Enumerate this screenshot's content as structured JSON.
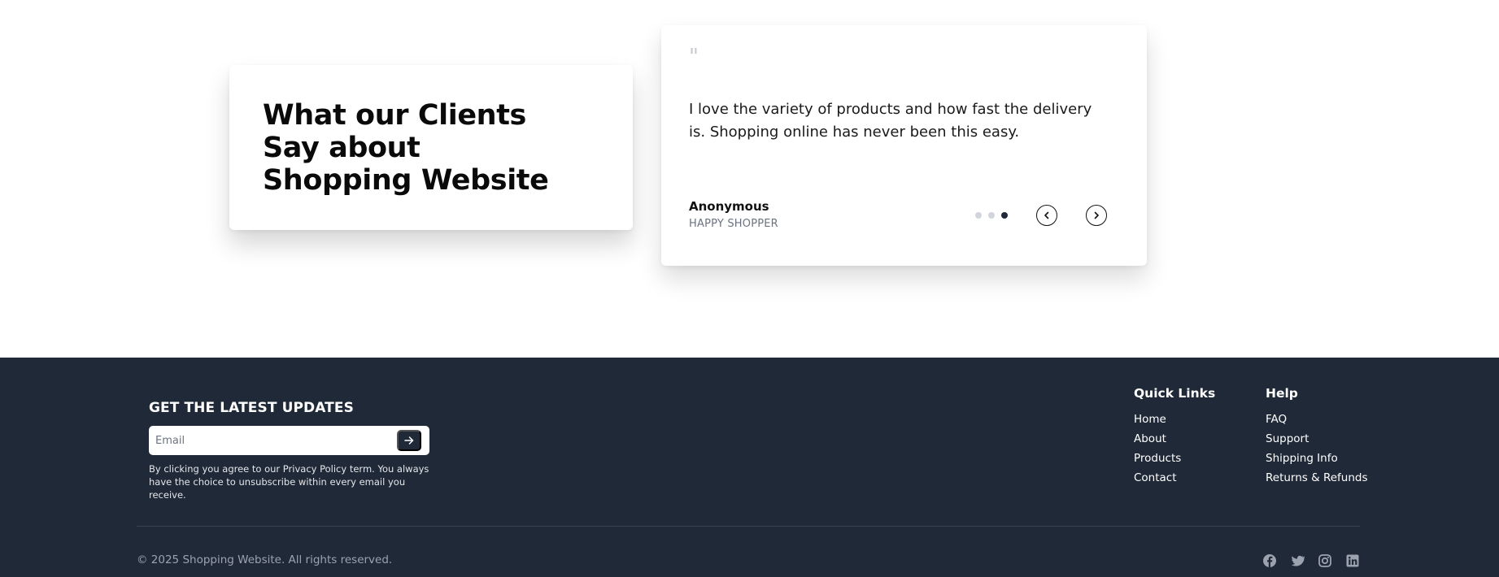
{
  "testimonials": {
    "heading": "What our Clients\nSay about\nShopping Website",
    "quote_mark": "\"",
    "quote": "I love the variety of products and how fast the delivery is. Shopping online has never been this easy.",
    "author": "Anonymous",
    "role": "HAPPY SHOPPER",
    "slides_total": 3,
    "active_slide": 3,
    "prev_icon": "chevron-left-icon",
    "next_icon": "chevron-right-icon"
  },
  "footer": {
    "updates_title": "GET THE LATEST UPDATES",
    "email_placeholder": "Email",
    "email_value": "",
    "submit_icon": "arrow-right-icon",
    "disclaimer": "By clicking you agree to our Privacy Policy term. You always have the choice to unsubscribe within every email you receive.",
    "quick_links": {
      "title": "Quick Links",
      "items": [
        "Home",
        "About",
        "Products",
        "Contact"
      ]
    },
    "help": {
      "title": "Help",
      "items": [
        "FAQ",
        "Support",
        "Shipping Info",
        "Returns & Refunds"
      ]
    },
    "copyright": "© 2025 Shopping Website. All rights reserved.",
    "socials": [
      "facebook-icon",
      "twitter-icon",
      "instagram-icon",
      "linkedin-icon"
    ]
  },
  "colors": {
    "footer_bg": "#1f2937",
    "text_dark": "#0a0a0a",
    "muted": "#6b7280",
    "dot_inactive": "#d1d5db",
    "dot_active": "#1f2937"
  }
}
